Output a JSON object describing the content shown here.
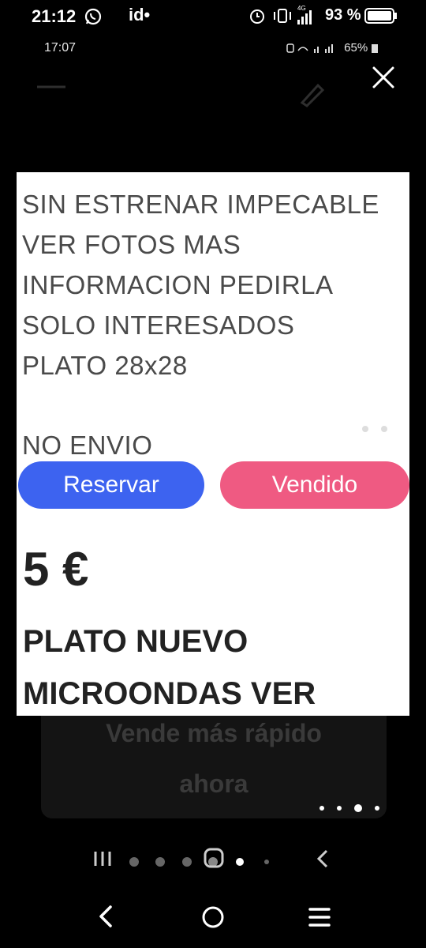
{
  "status_bar": {
    "time": "21:12",
    "battery_percent": "93 %",
    "carrier_glyph": "id•",
    "network": "4G"
  },
  "inner_status_bar": {
    "time": "17:07",
    "icons_text": "65%"
  },
  "listing": {
    "description_lines": [
      "SIN ESTRENAR  IMPECABLE",
      "VER FOTOS MAS",
      "INFORMACION PEDIRLA",
      "SOLO INTERESADOS",
      "PLATO 28x28",
      "NO ENVIO"
    ],
    "reserve_label": "Reservar",
    "sold_label": "Vendido",
    "price": "5 €",
    "title_lines": [
      "PLATO NUEVO",
      "MICROONDAS  VER"
    ]
  },
  "promo": {
    "line1": "Vende más rápido",
    "line2": "ahora"
  },
  "colors": {
    "reserve": "#3d63f0",
    "sold": "#ef5a82",
    "card": "#ffffff",
    "background": "#000000"
  }
}
